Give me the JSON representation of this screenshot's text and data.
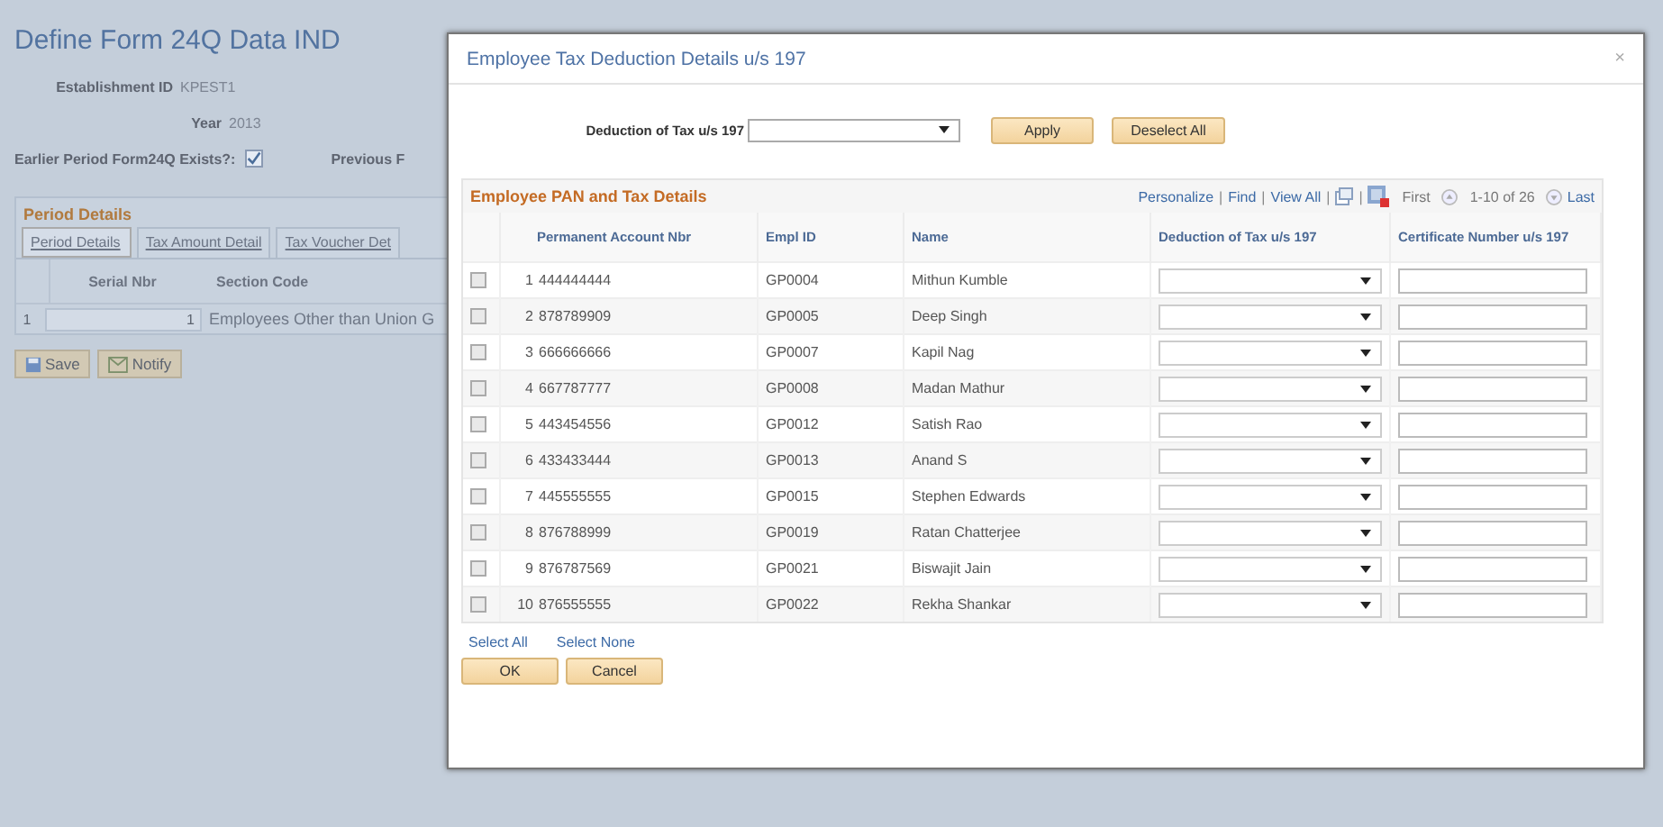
{
  "page": {
    "title": "Define Form 24Q Data IND",
    "fields": [
      {
        "label": "Establishment ID",
        "value": "KPEST1"
      },
      {
        "label": "Year",
        "value": "2013"
      }
    ],
    "earlier_period": {
      "label": "Earlier Period Form24Q Exists?:",
      "checked": true
    },
    "previous_label": "Previous F",
    "period_details": {
      "title": "Period Details",
      "tabs": [
        {
          "label": "Period Details",
          "selected": true
        },
        {
          "label": "Tax Amount Detail",
          "selected": false
        },
        {
          "label": "Tax Voucher Det",
          "selected": false
        }
      ],
      "columns": [
        "Serial Nbr",
        "Section Code"
      ],
      "rows": [
        {
          "row": "1",
          "serial": "1",
          "section": "Employees Other than Union G"
        }
      ]
    },
    "buttons": [
      {
        "label": "Save",
        "kind": "save"
      },
      {
        "label": "Notify",
        "kind": "notify"
      }
    ]
  },
  "dialog": {
    "title": "Employee Tax Deduction Details u/s 197",
    "close": "×",
    "deduction": {
      "label": "Deduction of Tax u/s 197"
    },
    "buttons": [
      "Apply",
      "Deselect All"
    ],
    "grid": {
      "title": "Employee PAN and Tax Details",
      "links": [
        "Personalize",
        "Find",
        "View All"
      ],
      "separator": "|",
      "first": "First",
      "range": "1-10 of 26",
      "last": "Last",
      "columns": [
        "Permanent Account Nbr",
        "Empl ID",
        "Name",
        "Deduction of Tax u/s 197",
        "Certificate Number u/s 197"
      ],
      "rows": [
        {
          "number": "1",
          "pan": "444444444",
          "empl_id": "GP0004",
          "name": "Mithun Kumble",
          "checked": false
        },
        {
          "number": "2",
          "pan": "878789909",
          "empl_id": "GP0005",
          "name": "Deep Singh",
          "checked": false
        },
        {
          "number": "3",
          "pan": "666666666",
          "empl_id": "GP0007",
          "name": "Kapil Nag",
          "checked": false
        },
        {
          "number": "4",
          "pan": "667787777",
          "empl_id": "GP0008",
          "name": "Madan Mathur",
          "checked": false
        },
        {
          "number": "5",
          "pan": "443454556",
          "empl_id": "GP0012",
          "name": "Satish Rao",
          "checked": false
        },
        {
          "number": "6",
          "pan": "433433444",
          "empl_id": "GP0013",
          "name": "Anand S",
          "checked": false
        },
        {
          "number": "7",
          "pan": "445555555",
          "empl_id": "GP0015",
          "name": "Stephen Edwards",
          "checked": false
        },
        {
          "number": "8",
          "pan": "876788999",
          "empl_id": "GP0019",
          "name": "Ratan Chatterjee",
          "checked": false
        },
        {
          "number": "9",
          "pan": "876787569",
          "empl_id": "GP0021",
          "name": "Biswajit Jain",
          "checked": false
        },
        {
          "number": "10",
          "pan": "876555555",
          "empl_id": "GP0022",
          "name": "Rekha Shankar",
          "checked": false
        }
      ]
    },
    "select_links": [
      "Select All",
      "Select None"
    ],
    "footer_buttons": [
      "OK",
      "Cancel"
    ]
  }
}
